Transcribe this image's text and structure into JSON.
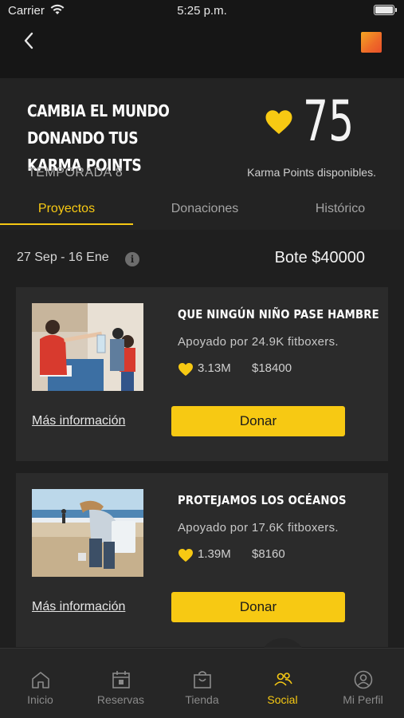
{
  "status_bar": {
    "carrier": "Carrier",
    "time": "5:25 p.m."
  },
  "hero": {
    "title": "CAMBIA EL MUNDO DONANDO TUS KARMA POINTS",
    "season": "TEMPORADA 8",
    "karma_points": "75",
    "karma_label": "Karma Points disponibles."
  },
  "tabs": [
    {
      "label": "Proyectos",
      "active": true
    },
    {
      "label": "Donaciones",
      "active": false
    },
    {
      "label": "Histórico",
      "active": false
    }
  ],
  "period": {
    "dates": "27 Sep - 16 Ene",
    "pot": "Bote $40000"
  },
  "projects": [
    {
      "title": "QUE NINGÚN NIÑO PASE HAMBRE",
      "supporters": "Apoyado por 24.9K fitboxers.",
      "points": "3.13M",
      "money": "$18400",
      "more_label": "Más información",
      "donate_label": "Donar"
    },
    {
      "title": "PROTEJAMOS LOS OCÉANOS",
      "supporters": "Apoyado por 17.6K fitboxers.",
      "points": "1.39M",
      "money": "$8160",
      "more_label": "Más información",
      "donate_label": "Donar"
    }
  ],
  "bottom_nav": [
    {
      "label": "Inicio",
      "icon": "home-icon"
    },
    {
      "label": "Reservas",
      "icon": "calendar-icon"
    },
    {
      "label": "Tienda",
      "icon": "shopping-bag-icon"
    },
    {
      "label": "Social",
      "icon": "people-icon",
      "active": true
    },
    {
      "label": "Mi Perfil",
      "icon": "profile-icon"
    }
  ],
  "colors": {
    "accent": "#f7c913",
    "background": "#1f1f1f",
    "card": "#2b2b2b"
  }
}
